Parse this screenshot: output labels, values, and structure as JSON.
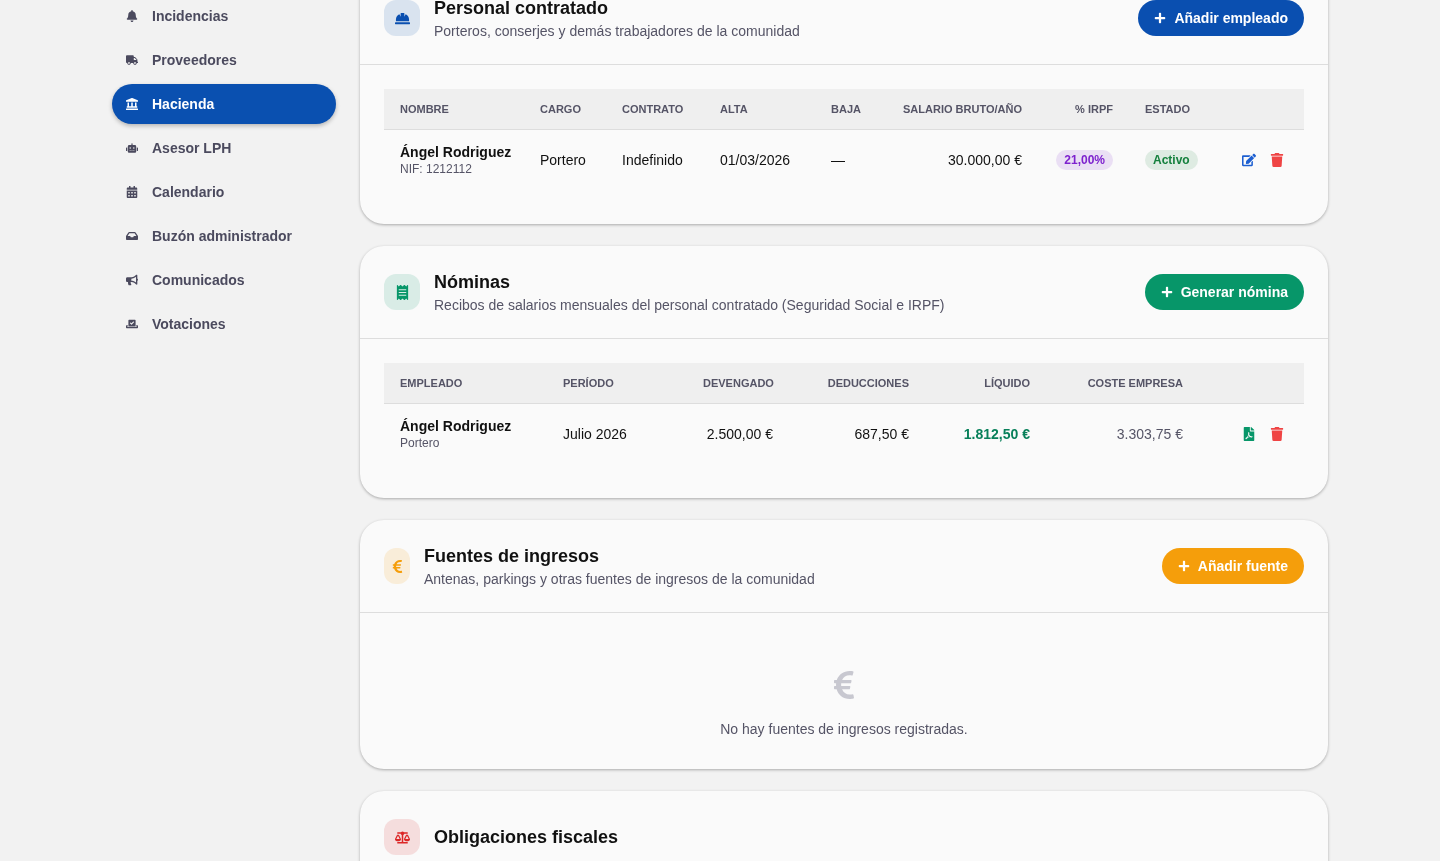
{
  "sidebar": {
    "items": [
      {
        "label": "Incidencias",
        "selected": false
      },
      {
        "label": "Proveedores",
        "selected": false
      },
      {
        "label": "Hacienda",
        "selected": true
      },
      {
        "label": "Asesor LPH",
        "selected": false
      },
      {
        "label": "Calendario",
        "selected": false
      },
      {
        "label": "Buzón administrador",
        "selected": false
      },
      {
        "label": "Comunicados",
        "selected": false
      },
      {
        "label": "Votaciones",
        "selected": false
      }
    ]
  },
  "cards": [
    {
      "kind": "staff",
      "color": "#0a4fb0",
      "title": "Personal contratado",
      "subtitle": "Porteros, conserjes y demás trabajadores de la comunidad",
      "button": "Añadir empleado",
      "table": {
        "columns": [
          {
            "label": "NOMBRE"
          },
          {
            "label": "CARGO"
          },
          {
            "label": "CONTRATO"
          },
          {
            "label": "ALTA"
          },
          {
            "label": "BAJA"
          },
          {
            "label": "SALARIO BRUTO/AÑO"
          },
          {
            "label": "% IRPF"
          },
          {
            "label": "ESTADO"
          },
          {}
        ],
        "rows": [
          [
            {
              "kind": "person",
              "text": "Ángel Rodriguez",
              "sub": "NIF: 1212112"
            },
            {
              "kind": "text",
              "text": "Portero"
            },
            {
              "kind": "text",
              "text": "Indefinido"
            },
            {
              "kind": "text",
              "text": "01/03/2026"
            },
            {
              "kind": "text",
              "text": "—"
            },
            {
              "kind": "money",
              "text": "30.000,00 €"
            },
            {
              "kind": "badge-right",
              "text": "21,00%",
              "color": "#7e22ce"
            },
            {
              "kind": "badge",
              "text": "Activo",
              "color": "#15803d"
            },
            {
              "kind": "edit-actions"
            }
          ]
        ]
      }
    },
    {
      "kind": "payroll",
      "color": "#079669",
      "title": "Nóminas",
      "subtitle": "Recibos de salarios mensuales del personal contratado (Seguridad Social e IRPF)",
      "button": "Generar nómina",
      "table": {
        "columns": [
          {
            "label": "EMPLEADO"
          },
          {
            "label": "PERÍODO"
          },
          {
            "label": "DEVENGADO"
          },
          {
            "label": "DEDUCCIONES"
          },
          {
            "label": "LÍQUIDO"
          },
          {
            "label": "COSTE EMPRESA"
          },
          {}
        ],
        "rows": [
          [
            {
              "kind": "person",
              "text": "Ángel Rodriguez",
              "sub": "Portero"
            },
            {
              "kind": "text",
              "text": "Julio 2026"
            },
            {
              "kind": "money",
              "text": "2.500,00 €"
            },
            {
              "kind": "money",
              "text": "687,50 €"
            },
            {
              "kind": "money-strong",
              "text": "1.812,50 €"
            },
            {
              "kind": "money-muted",
              "text": "3.303,75 €"
            },
            {
              "kind": "pdf-actions"
            }
          ]
        ]
      }
    },
    {
      "kind": "income",
      "color": "#f59e0b",
      "title": "Fuentes de ingresos",
      "subtitle": "Antenas, parkings y otras fuentes de ingresos de la comunidad",
      "button": "Añadir fuente",
      "empty": "No hay fuentes de ingresos registradas."
    },
    {
      "kind": "tax",
      "title": "Obligaciones fiscales"
    }
  ]
}
